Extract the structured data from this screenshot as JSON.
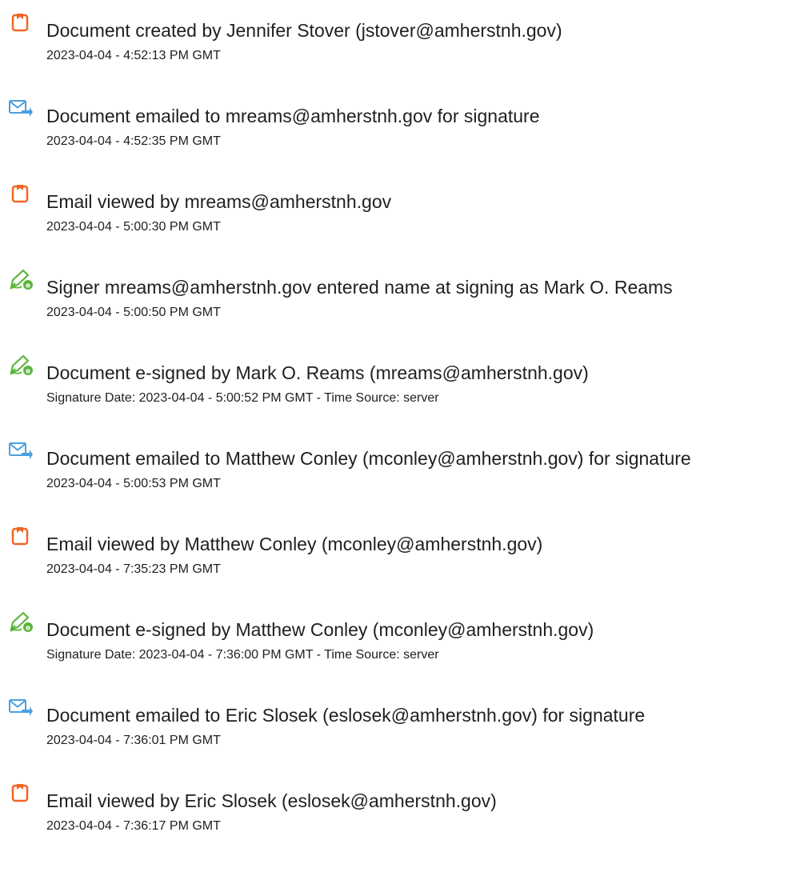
{
  "colors": {
    "text": "#1f1f1f",
    "doc_icon": "#f26522",
    "email_icon": "#4a9fe0",
    "sign_icon": "#5bb53b"
  },
  "events": [
    {
      "icon": "document-icon",
      "title": "Document created by Jennifer Stover (jstover@amherstnh.gov)",
      "detail": "2023-04-04 - 4:52:13 PM GMT"
    },
    {
      "icon": "email-sent-icon",
      "title": "Document emailed to mreams@amherstnh.gov for signature",
      "detail": "2023-04-04 - 4:52:35 PM GMT"
    },
    {
      "icon": "document-icon",
      "title": "Email viewed by mreams@amherstnh.gov",
      "detail": "2023-04-04 - 5:00:30 PM GMT"
    },
    {
      "icon": "esign-pen-icon",
      "title": "Signer mreams@amherstnh.gov entered name at signing as Mark O. Reams",
      "detail": "2023-04-04 - 5:00:50 PM GMT"
    },
    {
      "icon": "esign-pen-icon",
      "title": "Document e-signed by Mark O. Reams (mreams@amherstnh.gov)",
      "detail": "Signature Date: 2023-04-04 - 5:00:52 PM GMT - Time Source: server"
    },
    {
      "icon": "email-sent-icon",
      "title": "Document emailed to Matthew Conley (mconley@amherstnh.gov) for signature",
      "detail": "2023-04-04 - 5:00:53 PM GMT"
    },
    {
      "icon": "document-icon",
      "title": "Email viewed by Matthew Conley (mconley@amherstnh.gov)",
      "detail": "2023-04-04 - 7:35:23 PM GMT"
    },
    {
      "icon": "esign-pen-icon",
      "title": "Document e-signed by Matthew Conley (mconley@amherstnh.gov)",
      "detail": "Signature Date: 2023-04-04 - 7:36:00 PM GMT - Time Source: server"
    },
    {
      "icon": "email-sent-icon",
      "title": "Document emailed to Eric Slosek (eslosek@amherstnh.gov) for signature",
      "detail": "2023-04-04 - 7:36:01 PM GMT"
    },
    {
      "icon": "document-icon",
      "title": "Email viewed by Eric Slosek (eslosek@amherstnh.gov)",
      "detail": "2023-04-04 - 7:36:17 PM GMT"
    }
  ]
}
